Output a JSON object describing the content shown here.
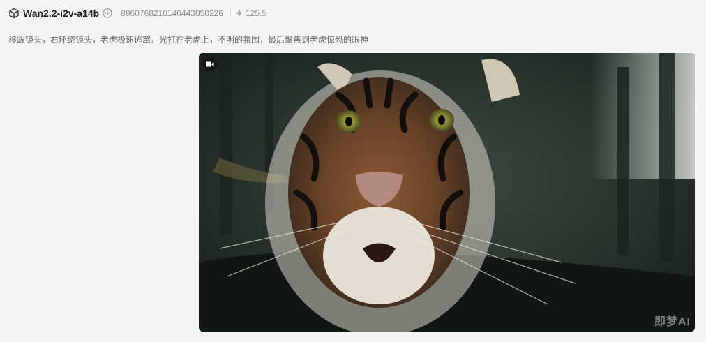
{
  "header": {
    "model_icon": "cube-icon",
    "model_name": "Wan2.2-i2v-a14b",
    "add_icon": "plus-circle-icon",
    "seed": "8960768210140443050226",
    "cost_icon": "lightning-icon",
    "cost": "125.5"
  },
  "prompt": "移跟镜头，右环绕镜头，老虎极速逃窜，光打在老虎上，不明的氛围，最后聚焦到老虎惊恐的眼神",
  "video": {
    "badge_icon": "video-camera-icon",
    "watermark": "即梦AI",
    "subject": "tiger-close-up"
  }
}
